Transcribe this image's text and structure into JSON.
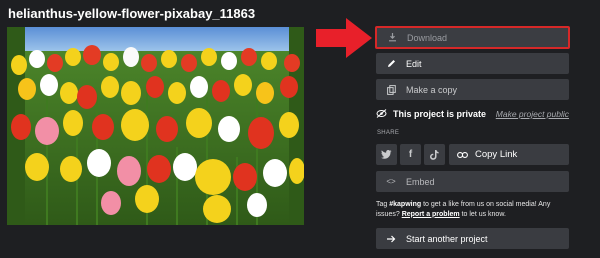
{
  "project": {
    "title": "helianthus-yellow-flower-pixabay_11863"
  },
  "preview": {
    "image_alt": "tulip-field-image"
  },
  "actions": {
    "download_label": "Download",
    "edit_label": "Edit",
    "copy_label": "Make a copy",
    "embed_label": "Embed",
    "another_label": "Start another project"
  },
  "privacy": {
    "status_label": "This project is private",
    "make_public_link": "Make project public"
  },
  "share": {
    "label": "SHARE",
    "twitter": "twitter",
    "facebook": "f",
    "tiktok": "tiktok",
    "copy_link_label": "Copy Link"
  },
  "tagline": {
    "prefix": "Tag ",
    "handle": "#kapwing",
    "middle": " to get a like from us on social media! Any issues? ",
    "report_link": "Report a problem",
    "suffix": " to let us know."
  },
  "colors": {
    "background": "#1e1f22",
    "button": "#3a3c41",
    "highlight": "#d62828"
  }
}
